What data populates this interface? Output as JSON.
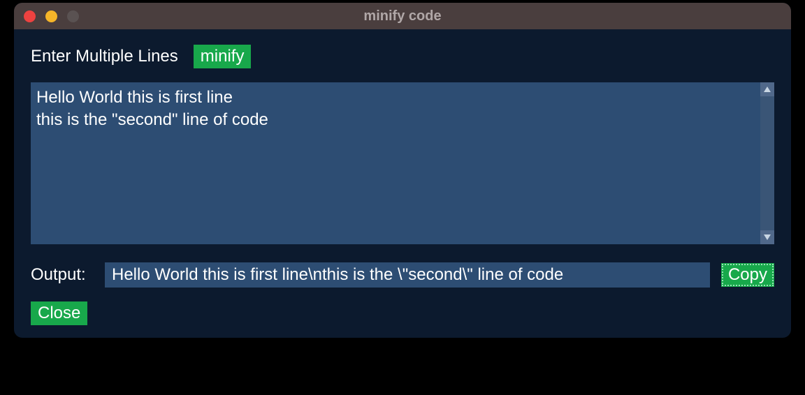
{
  "window": {
    "title": "minify code"
  },
  "header": {
    "label": "Enter Multiple Lines",
    "minify_button": "minify"
  },
  "input": {
    "value": "Hello World this is first line\nthis is the \"second\" line of code"
  },
  "output": {
    "label": "Output:",
    "value": "Hello World this is first line\\nthis is the \\\"second\\\" line of code",
    "copy_button": "Copy"
  },
  "footer": {
    "close_button": "Close"
  }
}
